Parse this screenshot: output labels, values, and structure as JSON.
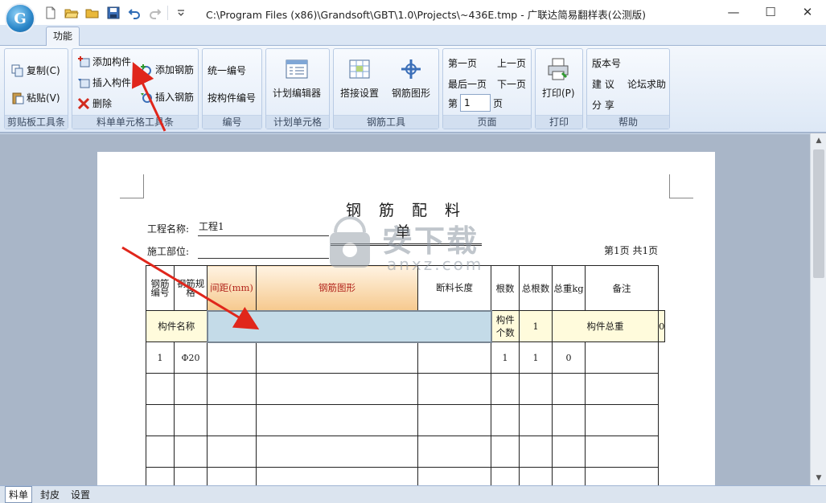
{
  "window": {
    "title": "C:\\Program Files (x86)\\Grandsoft\\GBT\\1.0\\Projects\\~436E.tmp - 广联达简易翻样表(公测版)",
    "app_icon": "grandsoft-orb-icon",
    "quick_access": [
      "new-icon",
      "open-icon",
      "open-folder-icon",
      "save-icon",
      "undo-icon",
      "redo-icon",
      "customize-dropdown-icon"
    ],
    "controls": {
      "minimize": "—",
      "maximize": "☐",
      "close": "✕"
    }
  },
  "ribbon": {
    "active_tab": "功能",
    "groups": {
      "clipboard": {
        "label": "剪贴板工具条",
        "copy": "复制(C)",
        "paste": "粘贴(V)"
      },
      "cells": {
        "label": "料单单元格工具条",
        "add_component": "添加构件",
        "insert_component": "插入构件",
        "delete": "删除",
        "add_rebar": "添加钢筋",
        "insert_rebar": "插入钢筋"
      },
      "numbering": {
        "label": "编号",
        "unified": "统一编号",
        "by_component": "按构件编号"
      },
      "plan_cell": {
        "label": "计划单元格",
        "editor": "计划编辑器"
      },
      "rebar_tools": {
        "label": "钢筋工具",
        "splice": "搭接设置",
        "shape": "钢筋图形"
      },
      "page": {
        "label": "页面",
        "first": "第一页",
        "prev": "上一页",
        "last": "最后一页",
        "next": "下一页",
        "page_prefix": "第",
        "page_value": "1",
        "page_suffix": "页"
      },
      "print": {
        "label": "打印",
        "print": "打印(P)"
      },
      "help": {
        "label": "帮助",
        "version": "版本号",
        "suggest": "建 议",
        "forum": "论坛求助",
        "share": "分 享"
      }
    }
  },
  "document": {
    "title": "钢 筋 配 料 单",
    "project_label": "工程名称:",
    "project_value": "工程1",
    "site_label": "施工部位:",
    "site_value": "",
    "page_info": "第1页 共1页",
    "headers": {
      "bar_no": "钢筋编号",
      "bar_spec": "钢筋规格",
      "spacing": "间距(mm)",
      "shape": "钢筋图形",
      "cut_length": "断料长度",
      "count": "根数",
      "total_count": "总根数",
      "total_weight": "总重kg",
      "remark": "备注"
    },
    "summary": {
      "component_name_label": "构件名称",
      "component_name_value": "",
      "component_count_label": "构件个数",
      "component_count_value": "1",
      "component_weight_label": "构件总重",
      "component_weight_value": "0"
    },
    "rows": [
      {
        "bar_no": "1",
        "spec": "Φ20",
        "spacing": "",
        "shape": "",
        "cut_length": "",
        "count": "1",
        "total_count": "1",
        "total_weight": "0",
        "remark": ""
      }
    ],
    "watermark": {
      "brand": "安下载",
      "domain": "anxz.com"
    }
  },
  "bottom_tabs": [
    "料单",
    "封皮",
    "设置"
  ],
  "active_bottom_tab": "料单",
  "colors": {
    "annotation": "#e0261b",
    "selection": "#c4dbe8",
    "header_orange": "#f6c98e",
    "summary_bg": "#fffbdc"
  }
}
